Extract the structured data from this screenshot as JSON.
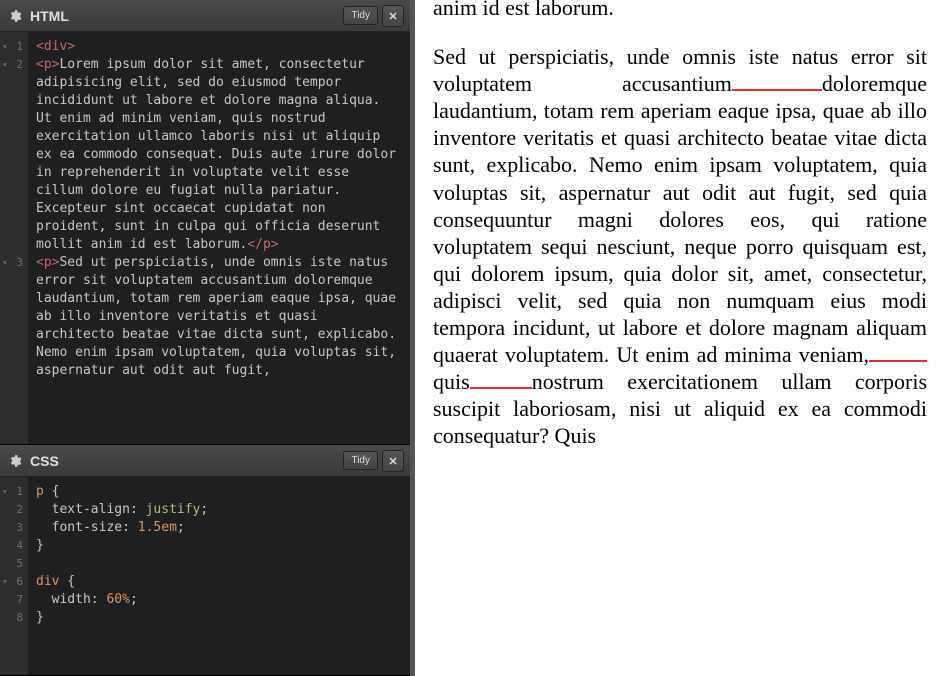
{
  "panels": {
    "html": {
      "title": "HTML",
      "tidy": "Tidy",
      "code": {
        "tag_div_open": "<div>",
        "tag_p_open": "<p>",
        "tag_p_close": "</p>",
        "para1": "Lorem ipsum dolor sit amet, consectetur adipisicing elit, sed do eiusmod tempor incididunt ut labore et dolore magna aliqua. Ut enim ad minim veniam, quis nostrud exercitation ullamco laboris nisi ut aliquip ex ea commodo consequat. Duis aute irure dolor in reprehenderit in voluptate velit esse cillum dolore eu fugiat nulla pariatur. Excepteur sint occaecat cupidatat non proident, sunt in culpa qui officia deserunt mollit anim id est laborum.",
        "para2": "Sed ut perspiciatis, unde omnis iste natus error sit voluptatem accusantium doloremque laudantium, totam rem aperiam eaque ipsa, quae ab illo inventore veritatis et quasi architecto beatae vitae dicta sunt, explicabo. Nemo enim ipsam voluptatem, quia voluptas sit, aspernatur aut odit aut fugit,"
      },
      "lines": {
        "l1": "1",
        "l2": "2",
        "l3": "3"
      }
    },
    "css": {
      "title": "CSS",
      "tidy": "Tidy",
      "code": {
        "l1_sel": "p",
        "l1_brace": " {",
        "l2_prop": "  text-align",
        "l2_val": "justify",
        "l3_prop": "  font-size",
        "l3_val": "1.5em",
        "l4": "}",
        "l6_sel": "div",
        "l6_brace": " {",
        "l7_prop": "  width",
        "l7_val": "60%",
        "l8": "}"
      },
      "lines": {
        "l1": "1",
        "l2": "2",
        "l3": "3",
        "l4": "4",
        "l5": "5",
        "l6": "6",
        "l7": "7",
        "l8": "8"
      }
    }
  },
  "preview": {
    "p0_tail": "anim id est laborum.",
    "p1_a": "Sed ut perspiciatis, unde omnis iste natus error sit voluptatem accusantium",
    "p1_b": "doloremque laudantium, totam rem aperiam eaque ipsa, quae ab illo inventore veritatis et quasi architecto beatae vitae dicta sunt, explicabo. Nemo enim ipsam voluptatem, quia voluptas sit, aspernatur aut odit aut fugit, sed quia consequuntur magni dolores eos, qui ratione voluptatem sequi nesciunt, neque porro quisquam est, qui dolorem ipsum, quia dolor sit, amet, consectetur, adipisci velit, sed quia non numquam eius modi tempora incidunt, ut labore et dolore magnam aliquam quaerat voluptatem. Ut enim ad minima veniam,",
    "p1_c": "quis",
    "p1_d": "nostrum exercitationem ullam corporis suscipit laboriosam, nisi ut aliquid ex ea commodi consequatur? Quis"
  }
}
